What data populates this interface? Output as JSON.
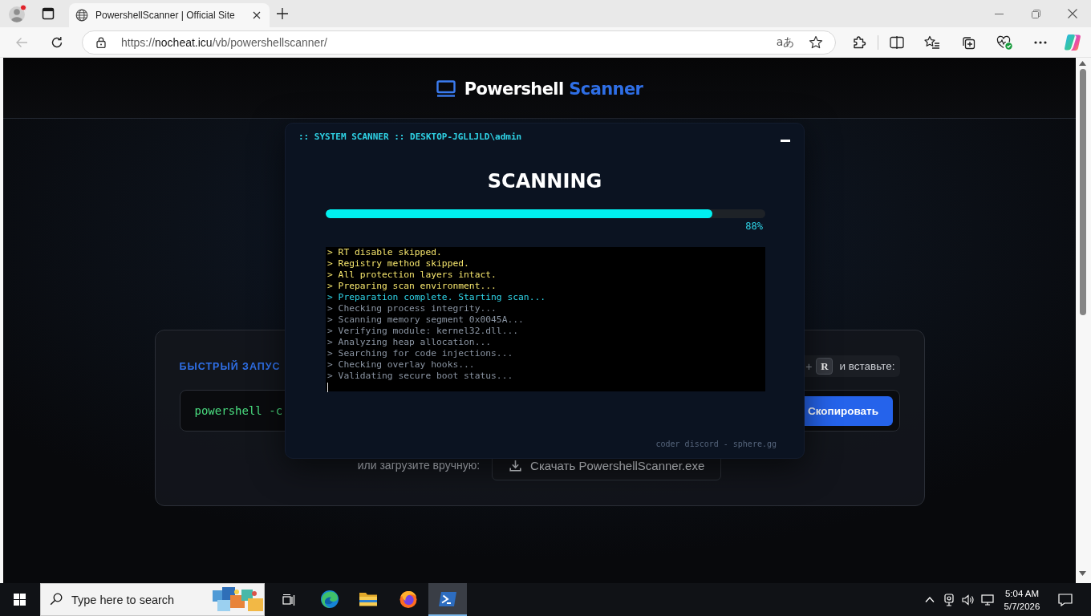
{
  "browser": {
    "tabs": [
      {
        "title": "PowershellScanner | Official Site",
        "selected": true
      }
    ],
    "address_bar": {
      "url": [
        {
          "text": "https://",
          "kind": "scheme"
        },
        {
          "text": "nocheat.icu",
          "kind": "host"
        },
        {
          "text": "/vb/powershellscanner/",
          "kind": "path"
        }
      ],
      "read_aloud": "aあ"
    }
  },
  "page": {
    "logo": [
      {
        "text": "Powershell",
        "kind": "primary"
      },
      {
        "text": "Scanner",
        "kind": "accent"
      }
    ],
    "quick_start": {
      "title": "БЫСТРЫЙ ЗАПУС",
      "hint": {
        "plus": "+",
        "key": "R",
        "text": "и вставьте:"
      },
      "command": "powershell -c",
      "copy_button": "Скопировать"
    },
    "download": {
      "label": "или загрузите вручную:",
      "button": "Скачать PowershellScanner.exe"
    }
  },
  "scanner_modal": {
    "title": ":: SYSTEM SCANNER :: DESKTOP-JGLLJLD\\admin",
    "status": "SCANNING",
    "progress": {
      "level": 0.88,
      "reading": "88%"
    },
    "log": [
      {
        "text": "> RT disable skipped.",
        "kind": "warning"
      },
      {
        "text": "> Registry method skipped.",
        "kind": "warning"
      },
      {
        "text": "> All protection layers intact.",
        "kind": "warning"
      },
      {
        "text": "> Preparing scan environment...",
        "kind": "warning"
      },
      {
        "text": "> Preparation complete. Starting scan...",
        "kind": "success"
      },
      {
        "text": "> Checking process integrity...",
        "kind": "info"
      },
      {
        "text": "> Scanning memory segment 0x0045A...",
        "kind": "info"
      },
      {
        "text": "> Verifying module: kernel32.dll...",
        "kind": "info"
      },
      {
        "text": "> Analyzing heap allocation...",
        "kind": "info"
      },
      {
        "text": "> Searching for code injections...",
        "kind": "info"
      },
      {
        "text": "> Checking overlay hooks...",
        "kind": "info"
      },
      {
        "text": "> Validating secure boot status...",
        "kind": "info"
      }
    ],
    "footer": "coder discord - sphere.gg"
  },
  "taskbar": {
    "search": {
      "placeholder": "Type here to search"
    },
    "apps": [
      {
        "kind": "edge",
        "selected": false
      },
      {
        "kind": "explorer",
        "selected": false
      },
      {
        "kind": "firefox",
        "selected": false
      },
      {
        "kind": "powershell",
        "selected": true
      }
    ],
    "clock": {
      "time": "5:04 AM",
      "date": "5/7/2026"
    }
  }
}
